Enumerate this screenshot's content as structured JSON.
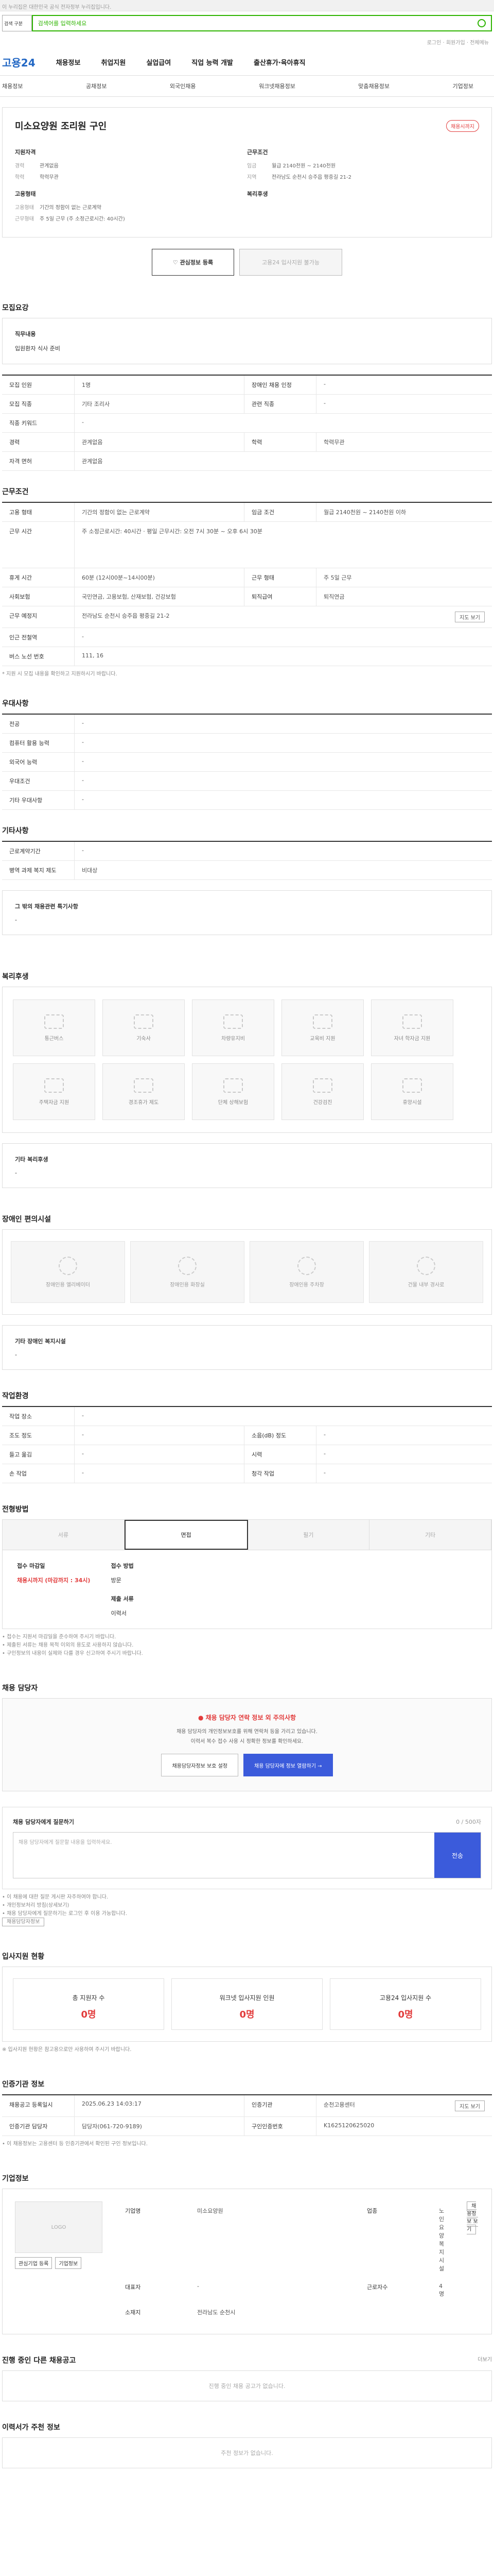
{
  "topbar": {
    "notice": "이 누리집은 대한민국 공식 전자정부 누리집입니다."
  },
  "search": {
    "gov_select": "검색 구분",
    "placeholder": "검색어를 입력하세요"
  },
  "util": {
    "links": "로그인 · 회원가입 · 전체메뉴"
  },
  "gnb": {
    "logo": "고용24",
    "items": [
      "채용정보",
      "취업지원",
      "실업급여",
      "직업 능력 개발",
      "출산휴가·육아휴직"
    ]
  },
  "lnb": {
    "items": [
      "채용정보",
      "공채정보",
      "외국인채용",
      "워크넷채용정보",
      "맞춤채용정보",
      "기업정보"
    ]
  },
  "header": {
    "title": "미소요양원 조리원 구인",
    "badge": "채용시까지",
    "company_label": "지원자격",
    "conditions_label": "근무조건",
    "career_k": "경력",
    "career_v": "관계없음",
    "edu_k": "학력",
    "edu_v": "학력무관",
    "salary_k": "임금",
    "salary_v": "월급 2140천원 ~ 2140천원",
    "region_k": "지역",
    "region_v": "전라남도 순천시 승주읍 평중길 21-2",
    "emp_label": "고용형태",
    "welfare_label": "복리후생",
    "emp_type_k": "고용형태",
    "emp_type_v": "기간의 정함이 없는 근로계약",
    "worktime_k": "근무형태",
    "worktime_v": "주 5일 근무 (주 소정근로시간: 40시간)"
  },
  "actions": {
    "interest": "관심정보 등록",
    "compare": "고용24 입사지원 불가능"
  },
  "sections": {
    "recruit": "모집요강",
    "work": "근무조건",
    "prefer": "우대사항",
    "etc": "기타사항",
    "welfare": "복리후생",
    "disability": "장애인 편의시설",
    "disability2": "기타 장애인 복지시설",
    "welfare2": "기타 복리후생",
    "env": "작업환경",
    "method": "전형방법",
    "contact": "채용 담당자",
    "inquiry": "채용 담당자에게 질문하기",
    "status": "입사지원 현황",
    "cert": "인증기관 정보",
    "company": "기업정보",
    "other_jobs": "진행 중인 다른 채용공고",
    "ai": "이력서가 주천 정보"
  },
  "recruit": {
    "job_head": "직무내용",
    "job_body": "입원환자 식사 준비",
    "rows": [
      {
        "k": "모집 인원",
        "v": "1명",
        "k2": "장애인 채용 인정",
        "v2": "-"
      },
      {
        "k": "모집 직종",
        "v": "기타 조리사",
        "k2": "관련 직종",
        "v2": "-"
      },
      {
        "k": "직종 키워드",
        "v": "-",
        "k2": "",
        "v2": ""
      },
      {
        "k": "경력",
        "v": "관계없음",
        "k2": "학력",
        "v2": "학력무관"
      },
      {
        "k": "자격 면허",
        "v": "관계없음",
        "k2": "",
        "v2": ""
      }
    ]
  },
  "work": {
    "rows": [
      {
        "k": "고용 형태",
        "v": "기간의 정함이 없는 근로계약",
        "k2": "임금 조건",
        "v2": "월급 2140천원 ~ 2140천원 이하"
      },
      {
        "k": "근무 시간",
        "v": "주 소정근로시간: 40시간 · 평일 근무시간: 오전 7시 30분 ~ 오후 6시 30분",
        "k2": "",
        "v2": ""
      },
      {
        "k": "휴게 시간",
        "v": "60분 (12시00분~14시00분)",
        "k2": "근무 형태",
        "v2": "주 5일 근무"
      },
      {
        "k": "사회보험",
        "v": "국민연금, 고용보험, 산재보험, 건강보험",
        "k2": "퇴직급여",
        "v2": "퇴직연금"
      },
      {
        "k": "근무 예정지",
        "v": "전라남도 순천시 승주읍 평중길 21-2",
        "k2": "",
        "v2": ""
      },
      {
        "k": "인근 전철역",
        "v": "-",
        "k2": "",
        "v2": ""
      },
      {
        "k": "버스 노선 번호",
        "v": "111, 16",
        "k2": "",
        "v2": ""
      }
    ],
    "note": "* 지원 시 모집 내용을 확인하고 지원하시기 바랍니다.",
    "map_btn": "지도 보기"
  },
  "prefer": {
    "rows": [
      {
        "k": "전공",
        "v": "-"
      },
      {
        "k": "컴퓨터 활용 능력",
        "v": "-"
      },
      {
        "k": "외국어 능력",
        "v": "-"
      },
      {
        "k": "우대조건",
        "v": "-"
      },
      {
        "k": "기타 우대사항",
        "v": "-"
      }
    ]
  },
  "etc": {
    "rows": [
      {
        "k": "근로계약기간",
        "v": "-"
      },
      {
        "k": "병역 과제 복지 제도",
        "v": "비대상"
      }
    ],
    "box_head": "그 밖의 채용관련 특기사항",
    "box_body": "-"
  },
  "welfare": {
    "items": [
      "통근버스",
      "기숙사",
      "차량유지비",
      "교육비 지원",
      "자녀 학자금 지원",
      "주택자금 지원",
      "경조휴가 제도",
      "단체 상해보험",
      "건강검진",
      "휴양시설"
    ],
    "other_head": "기타 복리후생",
    "other_body": "-"
  },
  "disability": {
    "items": [
      "장애인용 엘리베이터",
      "장애인용 화장실",
      "장애인용 주차장",
      "건물 내부 경사로"
    ],
    "other_head": "기타 장애인 복지시설",
    "other_body": "-"
  },
  "env": {
    "rows": [
      {
        "k": "작업 장소",
        "v": "-",
        "k2": "",
        "v2": ""
      },
      {
        "k": "조도 정도",
        "v": "-",
        "k2": "소음(dB) 정도",
        "v2": "-"
      },
      {
        "k": "들고 옮김",
        "v": "-",
        "k2": "시력",
        "v2": "-"
      },
      {
        "k": "손 작업",
        "v": "-",
        "k2": "청각 작업",
        "v2": "-"
      }
    ]
  },
  "method": {
    "tabs": [
      "서류",
      "면접",
      "필기",
      "기타"
    ],
    "receipt_head": "접수 마감일",
    "receipt_body": "채용시까지 (마감까지 : 34시)",
    "method_head": "접수 방법",
    "method_body": "방문",
    "docs_head": "제출 서류",
    "docs_body": "이력서",
    "notes": [
      "• 접수는 지원서 마감일을 준수하여 주시기 바랍니다.",
      "• 제출된 서류는 채용 목적 이외의 용도로 사용하지 않습니다.",
      "• 구인정보의 내용이 실제와 다를 경우 신고하여 주시기 바랍니다."
    ]
  },
  "contact": {
    "warn": "채용 담당자 연락 정보 외 주의사항",
    "line1": "채용 담당자의 개인정보보호를 위해 연락처 등을 가리고 있습니다.",
    "line2": "이력서 복수 접수 사용 시 정확한 정보를 확인하세요.",
    "btn1": "채용담당자정보 보호 설정",
    "btn2": "채용 담당자에 정보 열람하기 →"
  },
  "inquiry": {
    "head": "채용 담당자에게 질문하기",
    "placeholder": "채용 담당자에게 질문할 내용을 입력하세요.",
    "counter": "0 / 500자",
    "send": "전송",
    "notes": [
      "• 이 채용에 대한 질문 게시판 자주하여야 합니다.",
      "• 개인정보처리 방침(상세보기)",
      "• 채용 담당자에게 질문하기는 로그인 후 이용 가능합니다."
    ],
    "more": "채용담당자정보"
  },
  "status": {
    "items": [
      {
        "label": "총 지원자 수",
        "value": "0명"
      },
      {
        "label": "워크넷 입사지원 인원",
        "value": "0명"
      },
      {
        "label": "고용24 입사지원 수",
        "value": "0명"
      }
    ],
    "note": "※ 입사지원 현황은 참고용으로만 사용하여 주시기 바랍니다."
  },
  "cert": {
    "rows": [
      {
        "k": "채용공고 등록일시",
        "v": "2025.06.23 14:03:17",
        "k2": "인증기관",
        "v2": "순천고용센터"
      },
      {
        "k": "인증기관 담당자",
        "v": "담당자(061-720-9189)",
        "k2": "구인인증번호",
        "v2": "K1625120625020"
      }
    ],
    "btn": "지도 보기",
    "note": "• 이 채용정보는 고용센터 등 인증기관에서 확인된 구인 정보입니다."
  },
  "company": {
    "logo": "LOGO",
    "rows": [
      {
        "k": "기업명",
        "v": "미소요양원",
        "k2": "업종",
        "v2": "노인 요양 복지시설"
      },
      {
        "k": "대표자",
        "v": "-",
        "k2": "근로자수",
        "v2": "4명"
      },
      {
        "k": "소재지",
        "v": "전라남도 순천시",
        "k2": "",
        "v2": ""
      }
    ],
    "btn1": "관심기업 등록",
    "btn2": "기업정보",
    "map": "채용정보 보기"
  },
  "other_jobs": {
    "empty": "진행 중인 채용 공고가 없습니다.",
    "more": "더보기"
  },
  "ai": {
    "empty": "주천 정보가 없습니다."
  }
}
